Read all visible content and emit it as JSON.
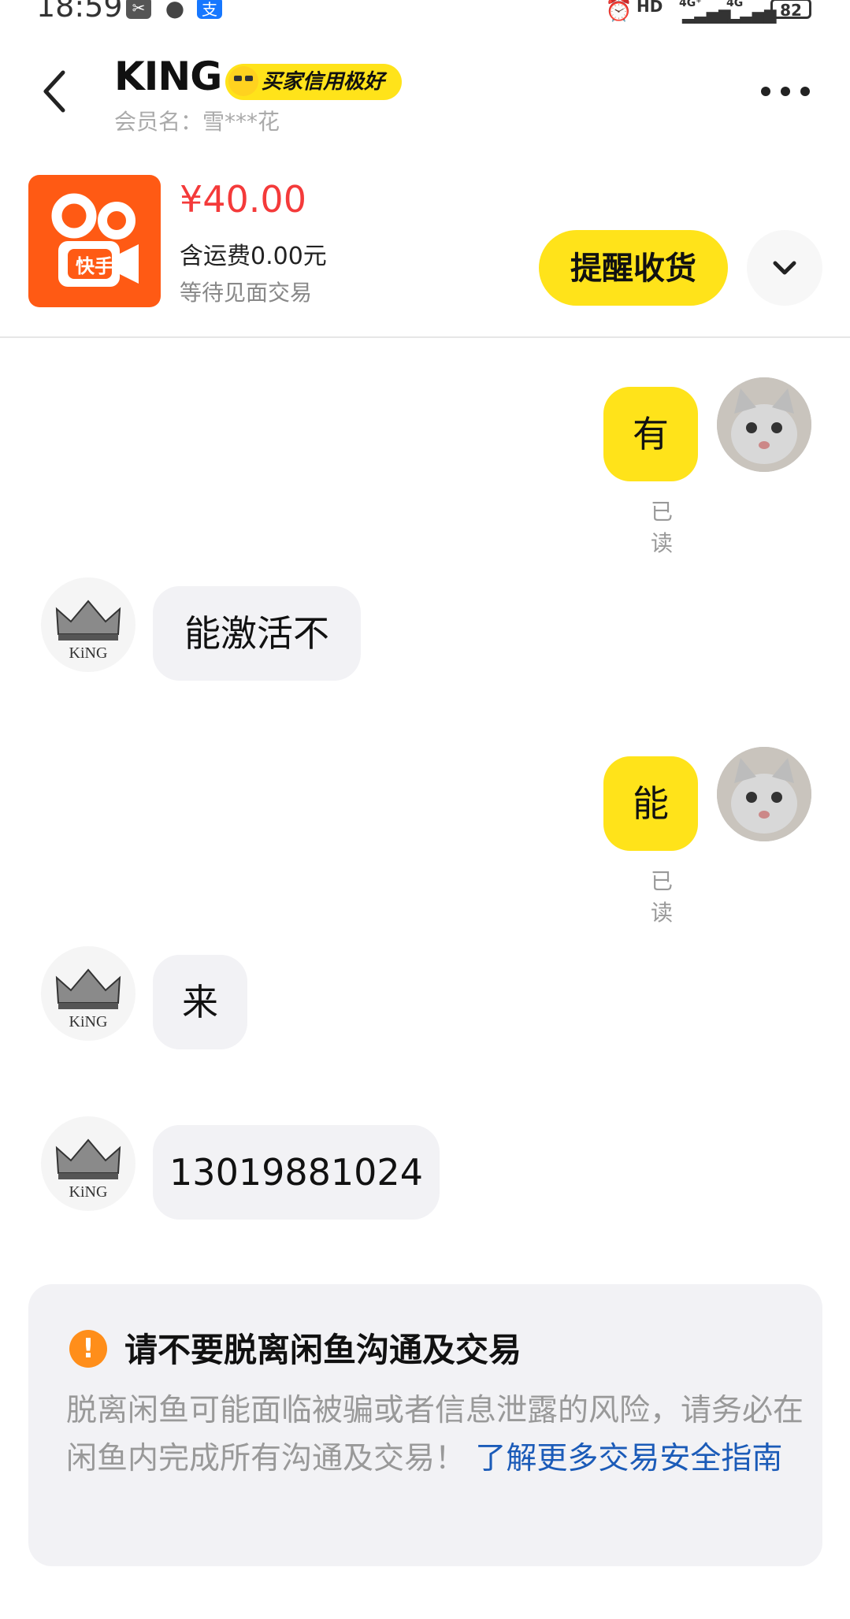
{
  "status_bar": {
    "time": "18:59",
    "network_1": "HD",
    "network_2": "4G⁺",
    "network_3": "4G",
    "battery": "82"
  },
  "header": {
    "title": "KING",
    "badge": "买家信用极好",
    "member_label": "会员名：雪***花"
  },
  "product": {
    "image_text": "快手",
    "price": "¥40.00",
    "shipping": "含运费0.00元",
    "status": "等待见面交易",
    "remind_button": "提醒收货"
  },
  "messages": [
    {
      "side": "mine",
      "text": "有",
      "read": "已读"
    },
    {
      "side": "theirs",
      "text": "能激活不"
    },
    {
      "side": "mine",
      "text": "能",
      "read": "已读"
    },
    {
      "side": "theirs",
      "text": "来"
    },
    {
      "side": "theirs",
      "text": "13019881024"
    }
  ],
  "notice": {
    "title": "请不要脱离闲鱼沟通及交易",
    "body": "脱离闲鱼可能面临被骗或者信息泄露的风险，请务必在闲鱼内完成所有沟通及交易！",
    "link": "了解更多交易安全指南"
  },
  "colors": {
    "accent_yellow": "#FFE31A",
    "price_red": "#F43A3A",
    "link_blue": "#1B5BB8",
    "warning_orange": "#FF8E1A"
  }
}
